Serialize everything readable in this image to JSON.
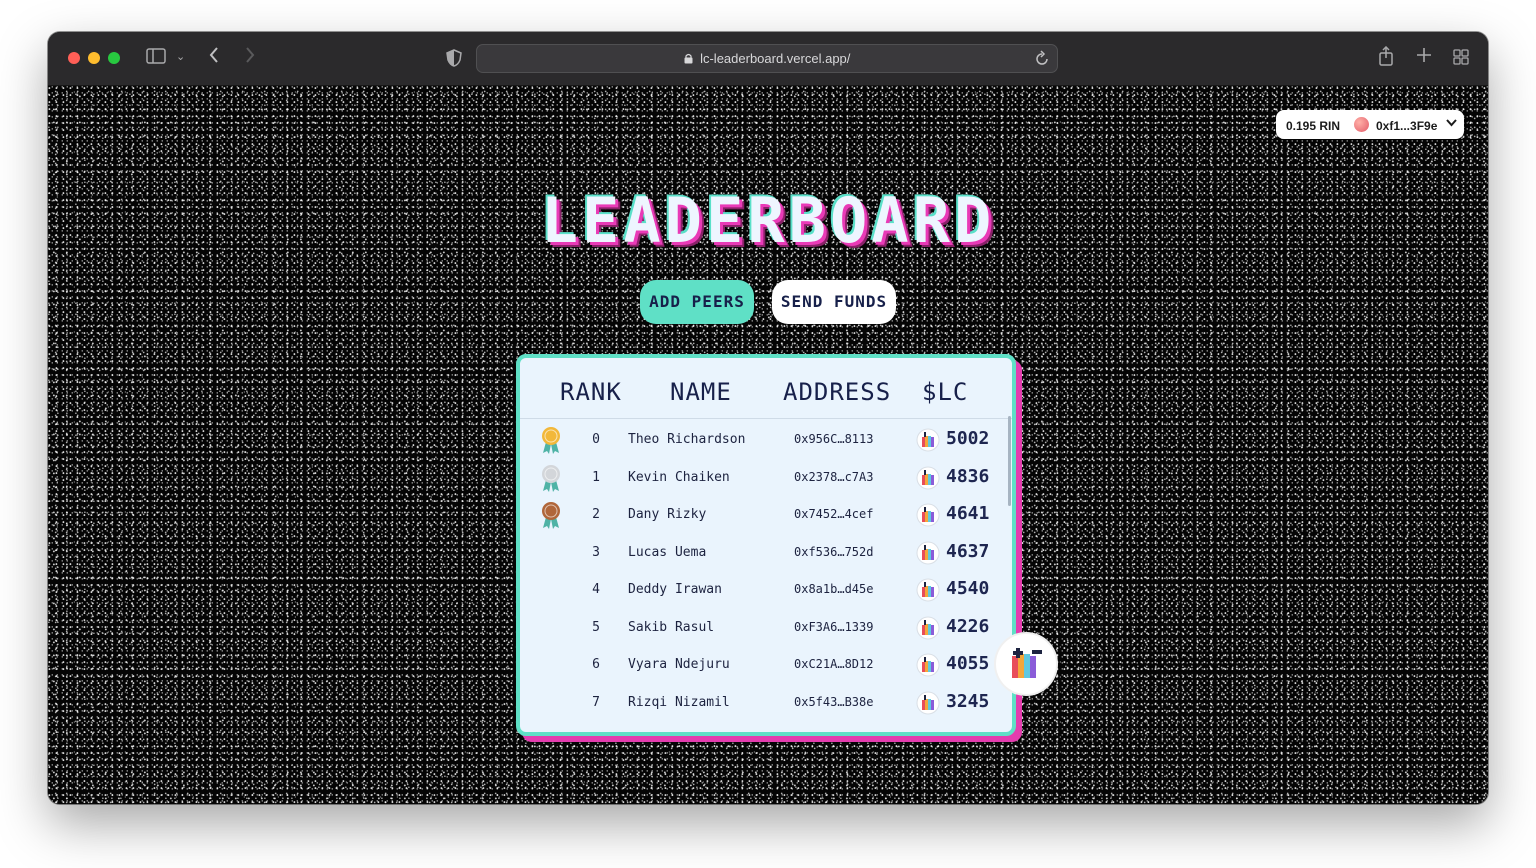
{
  "browser": {
    "url": "lc-leaderboard.vercel.app/"
  },
  "wallet": {
    "balance": "0.195 RIN",
    "account": "0xf1...3F9e"
  },
  "page": {
    "title": "LEADERBOARD",
    "add_peers_label": "ADD PEERS",
    "send_funds_label": "SEND FUNDS"
  },
  "table": {
    "headers": [
      "RANK",
      "NAME",
      "ADDRESS",
      "$LC"
    ],
    "rows": [
      {
        "rank": "0",
        "name": "Theo Richardson",
        "address": "0x956C…8113",
        "lc": "5002",
        "medal": "gold"
      },
      {
        "rank": "1",
        "name": "Kevin Chaiken",
        "address": "0x2378…c7A3",
        "lc": "4836",
        "medal": "silver"
      },
      {
        "rank": "2",
        "name": "Dany Rizky",
        "address": "0x7452…4cef",
        "lc": "4641",
        "medal": "bronze"
      },
      {
        "rank": "3",
        "name": "Lucas Uema",
        "address": "0xf536…752d",
        "lc": "4637",
        "medal": ""
      },
      {
        "rank": "4",
        "name": "Deddy Irawan",
        "address": "0x8a1b…d45e",
        "lc": "4540",
        "medal": ""
      },
      {
        "rank": "5",
        "name": "Sakib Rasul",
        "address": "0xF3A6…1339",
        "lc": "4226",
        "medal": ""
      },
      {
        "rank": "6",
        "name": "Vyara Ndejuru",
        "address": "0xC21A…8D12",
        "lc": "4055",
        "medal": ""
      },
      {
        "rank": "7",
        "name": "Rizqi Nizamil",
        "address": "0x5f43…B38e",
        "lc": "3245",
        "medal": ""
      }
    ]
  },
  "colors": {
    "accent_teal": "#5fe0c6",
    "accent_pink": "#e43cae",
    "navy_text": "#17204a",
    "card_bg": "#eaf4fd",
    "gold": "#f2b83a",
    "silver": "#d3d6da",
    "bronze": "#b0663a"
  },
  "icons": {
    "medal": "medal-icon",
    "coin": "lc-coin-icon",
    "lock": "lock-icon",
    "reload": "reload-icon",
    "share": "share-icon",
    "new_tab": "plus-icon",
    "tabs": "tab-overview-icon",
    "sidebar": "sidebar-icon",
    "privacy": "shield-icon"
  }
}
